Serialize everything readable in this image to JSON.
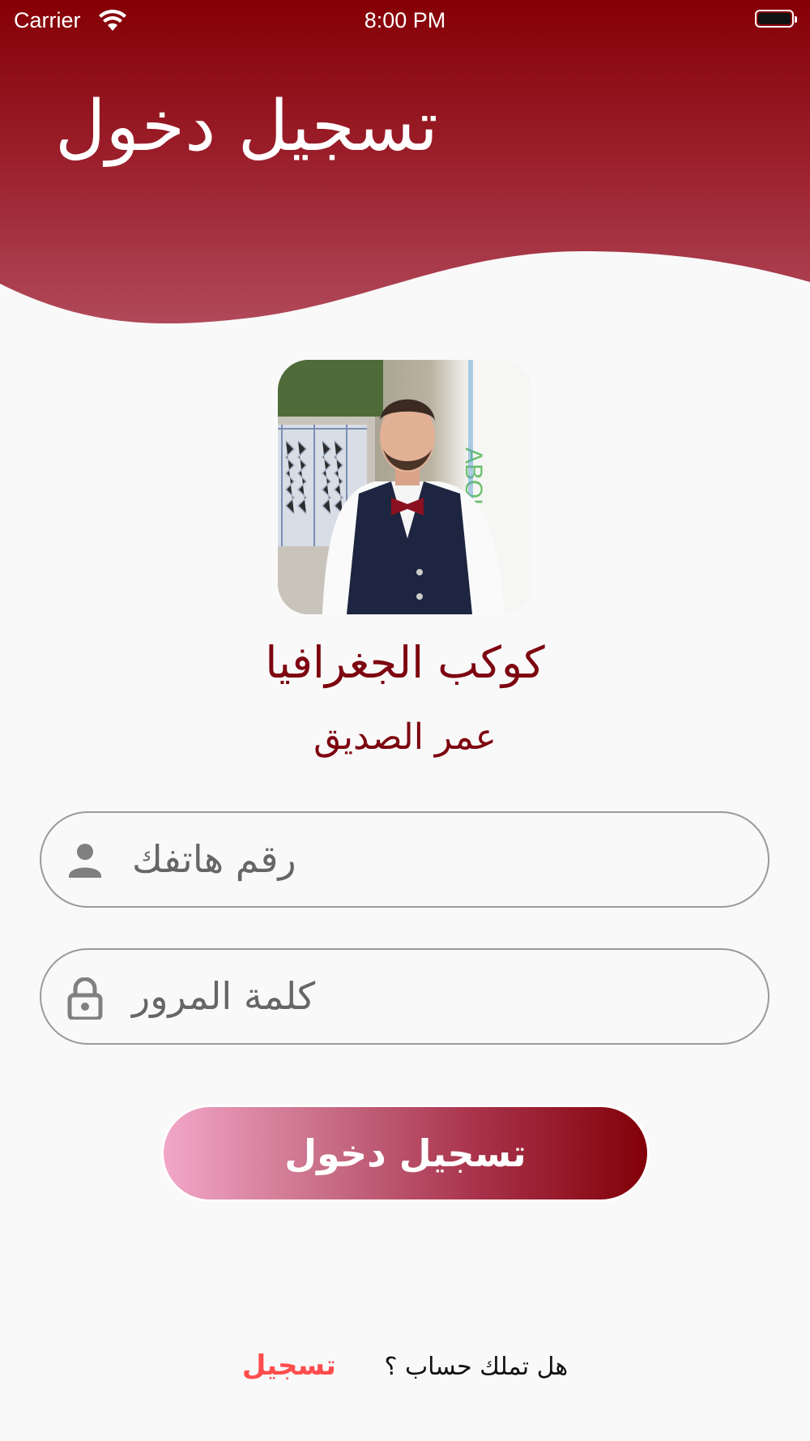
{
  "status_bar": {
    "carrier": "Carrier",
    "time": "8:00 PM",
    "wifi_icon": "wifi-icon",
    "battery_icon": "battery-full-icon"
  },
  "header": {
    "title": "تسجيل دخول",
    "gradient_colors": [
      "#850005",
      "#b24d5e"
    ]
  },
  "profile": {
    "app_name": "كوكب الجغرافيا",
    "author_name": "عمر الصديق",
    "text_color": "#7d0510"
  },
  "form": {
    "phone": {
      "placeholder": "رقم هاتفك",
      "icon": "person-icon"
    },
    "password": {
      "placeholder": "كلمة المرور",
      "icon": "lock-icon"
    },
    "login_button_label": "تسجيل دخول",
    "button_gradient": [
      "#f2a7c8",
      "#820008"
    ]
  },
  "footer": {
    "question": "هل تملك حساب ؟",
    "register_label": "تسجيل",
    "register_color": "#ff4d4d"
  }
}
